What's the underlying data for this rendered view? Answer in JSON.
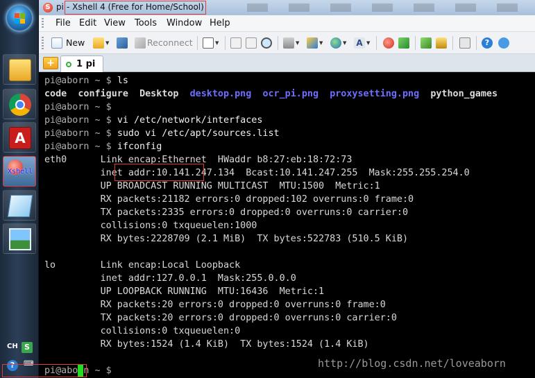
{
  "window": {
    "title_prefix": "pi",
    "title": "- Xshell 4 (Free for Home/School)"
  },
  "menu": [
    "File",
    "Edit",
    "View",
    "Tools",
    "Window",
    "Help"
  ],
  "toolbar": {
    "new_label": "New",
    "reconnect_label": "Reconnect"
  },
  "tabs": [
    {
      "label": "1 pi"
    }
  ],
  "taskbar": {
    "xshell_label": "Xshell",
    "tray_lang": "CH",
    "tray_s": "S",
    "tray_help": "?"
  },
  "terminal": {
    "lines": [
      {
        "prompt": "pi@aborn ~ $ ",
        "cmd": "ls"
      },
      {
        "files": [
          {
            "t": "code",
            "c": "file"
          },
          {
            "t": "configure",
            "c": "file"
          },
          {
            "t": "Desktop",
            "c": "file"
          },
          {
            "t": "desktop.png",
            "c": "png"
          },
          {
            "t": "ocr_pi.png",
            "c": "png"
          },
          {
            "t": "proxysetting.png",
            "c": "png"
          },
          {
            "t": "python_games",
            "c": "file"
          }
        ]
      },
      {
        "prompt": "pi@aborn ~ $ ",
        "cmd": ""
      },
      {
        "prompt": "pi@aborn ~ $ ",
        "cmd": "vi /etc/network/interfaces"
      },
      {
        "prompt": "pi@aborn ~ $ ",
        "cmd": "sudo vi /etc/apt/sources.list"
      },
      {
        "prompt": "pi@aborn ~ $ ",
        "cmd": "ifconfig"
      },
      {
        "out": "eth0      Link encap:Ethernet  HWaddr b8:27:eb:18:72:73"
      },
      {
        "out": "          inet addr:10.141.247.134  Bcast:10.141.247.255  Mask:255.255.254.0"
      },
      {
        "out": "          UP BROADCAST RUNNING MULTICAST  MTU:1500  Metric:1"
      },
      {
        "out": "          RX packets:21182 errors:0 dropped:102 overruns:0 frame:0"
      },
      {
        "out": "          TX packets:2335 errors:0 dropped:0 overruns:0 carrier:0"
      },
      {
        "out": "          collisions:0 txqueuelen:1000"
      },
      {
        "out": "          RX bytes:2228709 (2.1 MiB)  TX bytes:522783 (510.5 KiB)"
      },
      {
        "out": ""
      },
      {
        "out": "lo        Link encap:Local Loopback"
      },
      {
        "out": "          inet addr:127.0.0.1  Mask:255.0.0.0"
      },
      {
        "out": "          UP LOOPBACK RUNNING  MTU:16436  Metric:1"
      },
      {
        "out": "          RX packets:20 errors:0 dropped:0 overruns:0 frame:0"
      },
      {
        "out": "          TX packets:20 errors:0 dropped:0 overruns:0 carrier:0"
      },
      {
        "out": "          collisions:0 txqueuelen:0"
      },
      {
        "out": "          RX bytes:1524 (1.4 KiB)  TX bytes:1524 (1.4 KiB)"
      },
      {
        "out": ""
      },
      {
        "prompt": "pi@aborn ~ $ ",
        "cmd": ""
      }
    ],
    "watermark": "http://blog.csdn.net/loveaborn"
  },
  "colors": {
    "highlight_box": "#e23a3a",
    "cursor": "#22dd22",
    "png_files": "#6f6fff"
  }
}
